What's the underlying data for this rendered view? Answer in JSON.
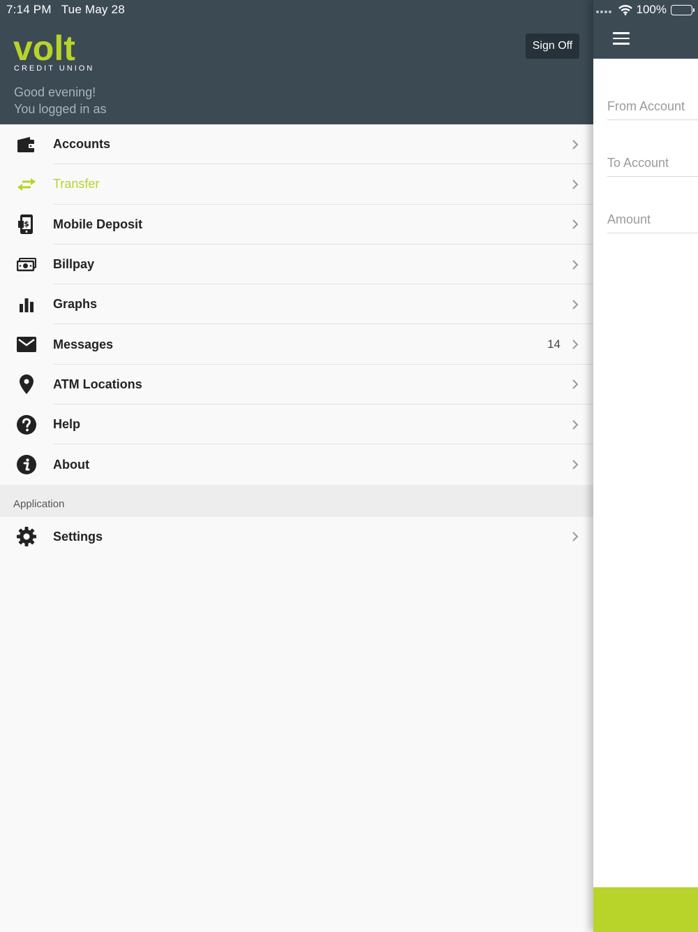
{
  "status_bar": {
    "time": "7:14 PM",
    "date": "Tue May 28",
    "battery": "100%"
  },
  "header": {
    "logo_text": "volt",
    "logo_subtext": "CREDIT UNION",
    "sign_off_label": "Sign Off",
    "greeting_line1": "Good evening!",
    "greeting_line2": "You logged in as"
  },
  "menu": {
    "items": [
      {
        "label": "Accounts",
        "icon": "wallet-icon"
      },
      {
        "label": "Transfer",
        "icon": "transfer-arrows-icon",
        "active": true
      },
      {
        "label": "Mobile Deposit",
        "icon": "mobile-deposit-icon"
      },
      {
        "label": "Billpay",
        "icon": "money-bill-icon"
      },
      {
        "label": "Graphs",
        "icon": "bar-chart-icon"
      },
      {
        "label": "Messages",
        "icon": "envelope-icon",
        "badge": "14"
      },
      {
        "label": "ATM Locations",
        "icon": "map-pin-icon"
      },
      {
        "label": "Help",
        "icon": "question-circle-icon"
      },
      {
        "label": "About",
        "icon": "info-circle-icon"
      }
    ],
    "section_label": "Application",
    "settings_label": "Settings"
  },
  "transfer_form": {
    "from_placeholder": "From Account",
    "to_placeholder": "To Account",
    "amount_placeholder": "Amount"
  },
  "colors": {
    "accent": "#b8d42a",
    "header_bg": "#3c4a54",
    "button_bg": "#263139"
  }
}
